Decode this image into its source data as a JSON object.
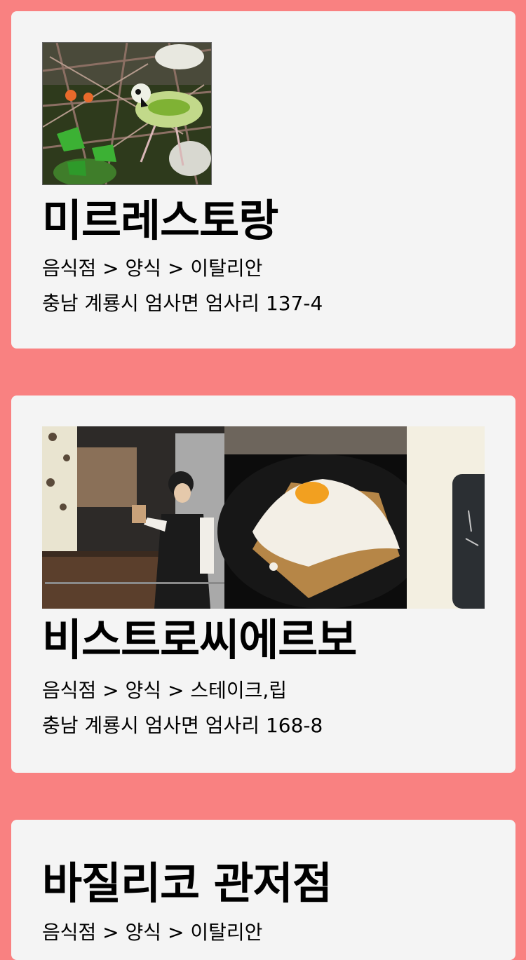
{
  "places": [
    {
      "title": "미르레스토랑",
      "category": "음식점 > 양식 > 이탈리안",
      "address": "충남 계룡시 엄사면 엄사리 137-4",
      "images": [
        "bird-in-foliage-photo"
      ]
    },
    {
      "title": "비스트로씨에르보",
      "category": "음식점 > 양식 > 스테이크,립",
      "address": "충남 계룡시 엄사면 엄사리 168-8",
      "images": [
        "barista-at-counter-photo",
        "coconut-cake-slice-photo",
        "business-card-photo"
      ]
    },
    {
      "title": "바질리코 관저점",
      "category": "음식점 > 양식 > 이탈리안"
    }
  ],
  "colors": {
    "page_background": "#f98181",
    "card_background": "#f4f4f4"
  }
}
